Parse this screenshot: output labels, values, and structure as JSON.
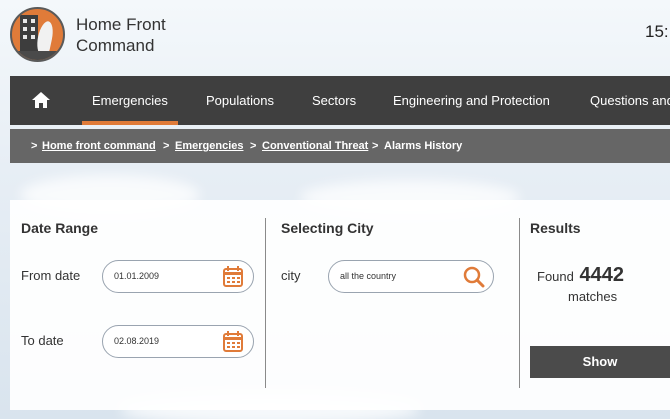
{
  "header": {
    "brand_line1": "Home Front",
    "brand_line2": "Command",
    "clock": "15:"
  },
  "nav": {
    "items": [
      {
        "label": "Emergencies",
        "active": true
      },
      {
        "label": "Populations"
      },
      {
        "label": "Sectors"
      },
      {
        "label": "Engineering and Protection"
      },
      {
        "label": "Questions and"
      }
    ]
  },
  "breadcrumb": [
    {
      "label": "Home front command",
      "link": true
    },
    {
      "label": "Emergencies",
      "link": true
    },
    {
      "label": "Conventional Threat",
      "link": true
    },
    {
      "label": "Alarms History",
      "link": false
    }
  ],
  "date_range": {
    "title": "Date Range",
    "from_label": "From date",
    "from_value": "01.01.2009",
    "to_label": "To date",
    "to_value": "02.08.2019"
  },
  "city": {
    "title": "Selecting City",
    "label": "city",
    "value": "all the country"
  },
  "results": {
    "title": "Results",
    "found_label": "Found",
    "count": "4442",
    "matches_label": "matches",
    "show_label": "Show"
  },
  "colors": {
    "accent": "#e07b39",
    "nav_bg": "#3f3f3f",
    "breadcrumb_bg": "#666666"
  }
}
